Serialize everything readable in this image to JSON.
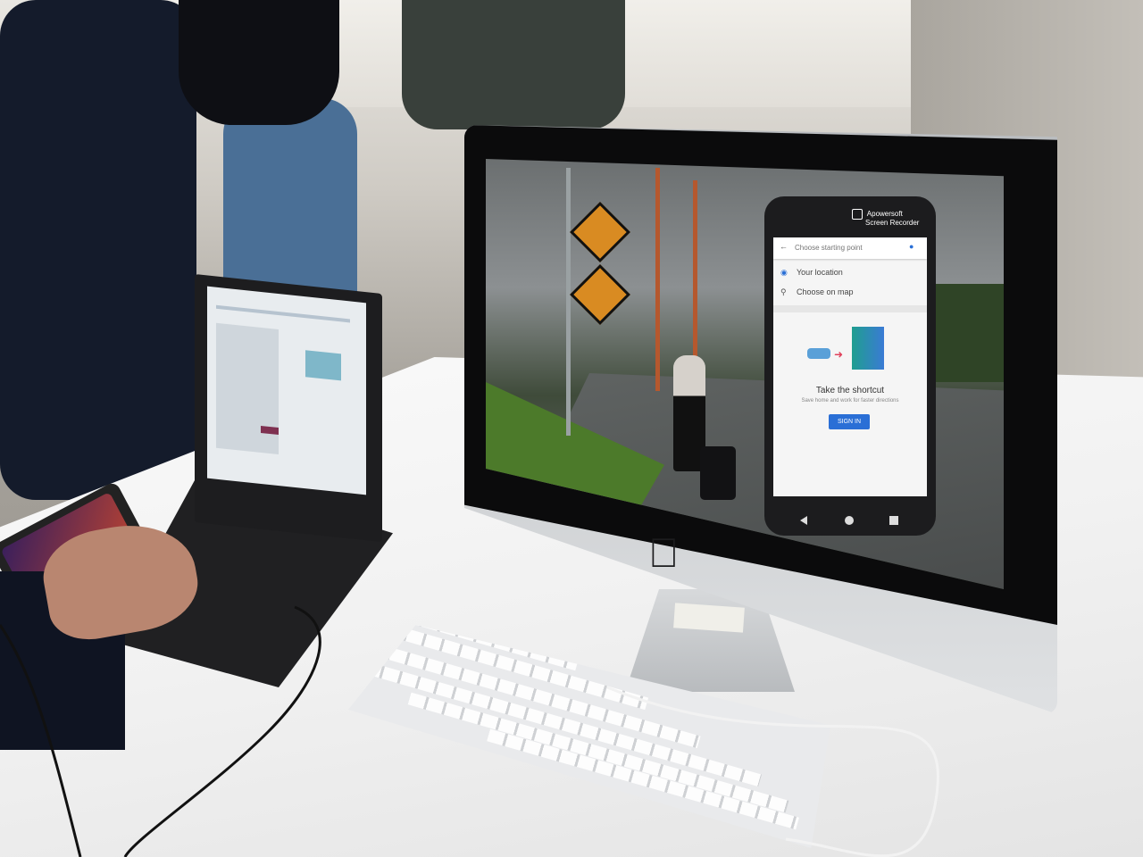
{
  "scene": {
    "description_hidden": null
  },
  "imac_screen": {
    "recorder_badge": {
      "line1": "Apowersoft",
      "line2": "Screen Recorder"
    },
    "phone_app": {
      "search_placeholder": "Choose starting point",
      "location_item": "Your location",
      "map_item": "Choose on map",
      "shortcut_title": "Take the shortcut",
      "shortcut_subtitle": "Save home and work for faster directions",
      "signin_label": "SIGN IN"
    }
  },
  "colors": {
    "signin_button": "#2a6fd6",
    "road_sign": "#d98b22",
    "grass": "#4c7a2a"
  },
  "icons": [
    "back-arrow-icon",
    "mic-icon",
    "location-dot-icon",
    "map-pin-icon",
    "car-icon",
    "arrow-right-icon",
    "building-icon",
    "apple-logo-icon",
    "record-icon"
  ]
}
